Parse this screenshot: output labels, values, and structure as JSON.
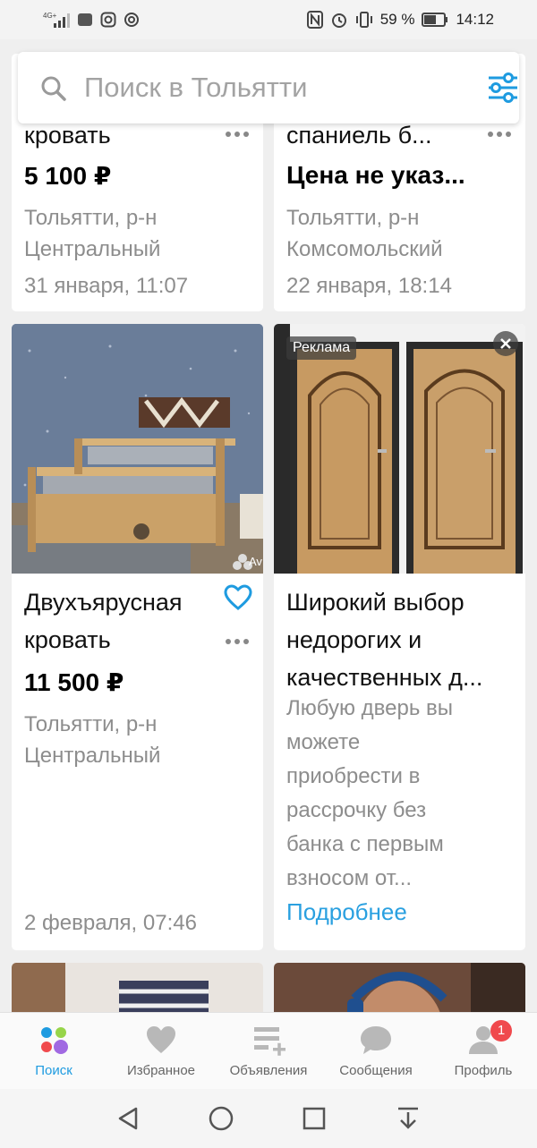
{
  "status_bar": {
    "network": "4G+",
    "battery_percent": "59 %",
    "time": "14:12"
  },
  "search": {
    "placeholder": "Поиск в Тольятти"
  },
  "listings": [
    {
      "title": "кровать",
      "price": "5 100 ₽",
      "location_line1": "Тольятти, р-н",
      "location_line2": "Центральный",
      "date": "31 января, 11:07"
    },
    {
      "title": "спаниель б...",
      "price": "Цена не указ...",
      "location_line1": "Тольятти, р-н",
      "location_line2": "Комсомольский",
      "date": "22 января, 18:14"
    },
    {
      "title_line1": "Двухъярусная",
      "title_line2": "кровать",
      "price": "11 500 ₽",
      "location_line1": "Тольятти, р-н",
      "location_line2": "Центральный",
      "date": "2 февраля, 07:46",
      "photo_watermark": "Av"
    }
  ],
  "ad": {
    "label": "Реклама",
    "title_line1": "Широкий выбор",
    "title_line2": "недорогих и",
    "title_line3": "качественных д...",
    "desc_lines": [
      "Любую дверь вы",
      "можете",
      "приобрести в",
      "рассрочку без",
      "банка с первым",
      "взносом от..."
    ],
    "more_link": "Подробнее"
  },
  "bottom_nav": {
    "items": [
      {
        "label": "Поиск",
        "icon": "search-dots-icon",
        "active": true
      },
      {
        "label": "Избранное",
        "icon": "heart-icon"
      },
      {
        "label": "Объявления",
        "icon": "add-listing-icon"
      },
      {
        "label": "Сообщения",
        "icon": "chat-icon"
      },
      {
        "label": "Профиль",
        "icon": "profile-icon",
        "badge": "1"
      }
    ]
  },
  "colors": {
    "accent": "#1e9be0",
    "badge": "#f0494d",
    "link": "#2aa0e0"
  }
}
